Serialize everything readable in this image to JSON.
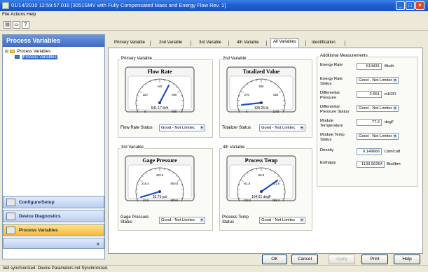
{
  "window": {
    "title": "01/14/2010 12:59:57.010 [3051SMV with Fully Compensated Mass and Energy Flow Rev. 1]"
  },
  "menu": {
    "items": [
      "File",
      "Actions",
      "Help"
    ]
  },
  "toolbar": {
    "icons": [
      "print-icon",
      "print-preview-icon",
      "whats-this-help-icon"
    ]
  },
  "leftpane": {
    "header": "Process Variables",
    "tree": {
      "root": "Process Variables",
      "child": "Process Variables"
    },
    "nav": [
      {
        "label": "Configure/Setup",
        "icon": "wrench-icon"
      },
      {
        "label": "Device Diagnostics",
        "icon": "diagnostics-icon"
      },
      {
        "label": "Process Variables",
        "icon": "variables-icon"
      }
    ],
    "footer_icon": "chevron-more-icon"
  },
  "tabs": [
    "Primary Variable",
    "2nd Variable",
    "3rd Variable",
    "4th Variable",
    "All Variables",
    "Identification"
  ],
  "selected_tab": "All Variables",
  "groups": {
    "primary": {
      "title": "Primary Variable",
      "gauge_title": "Flow Rate",
      "min": "0",
      "max": "880",
      "ticks": [
        "0",
        "220",
        "440",
        "660",
        "880"
      ],
      "value": 541.17,
      "readout": "541.17 lb/h",
      "status_label": "Flow Rate Status",
      "status": "Good - Not Limitec"
    },
    "second": {
      "title": "2nd Variable",
      "gauge_title": "Totalized Value",
      "min": "0",
      "max": "1100",
      "ticks": [
        "0",
        "275",
        "550",
        "825",
        "1100"
      ],
      "value": 109.25,
      "readout": "109.25 lb",
      "status_label": "Totalizer Status",
      "status": "Good - Not Limitec"
    },
    "third": {
      "title": "3rd Variable",
      "gauge_title": "Gage Pressure",
      "min": "-12.9",
      "max": "800.8",
      "ticks": [
        "-12.9",
        "216.4",
        "403.6",
        "600.8",
        "800.8"
      ],
      "value": 32.7,
      "readout": "32.70 psi",
      "status_label": "Gage Pressure Status",
      "status": "Good - Not Limitec"
    },
    "fourth": {
      "title": "4th Variable",
      "gauge_title": "Process Temp",
      "min": "-422.2",
      "max": "298.2",
      "ticks": [
        "-422.2",
        "-61.8",
        "59.8",
        "141.9",
        "298.2"
      ],
      "value": 104.01,
      "readout": "104.01 degF",
      "status_label": "Process Temp Status",
      "status": "Good - Not Limitec"
    }
  },
  "additional": {
    "title": "Additional Measurements",
    "rows": [
      {
        "label": "Energy Rate",
        "value": "613431",
        "unit": "Btu/h"
      },
      {
        "label": "Energy Rate Status",
        "status": "Good - Not Limitec"
      },
      {
        "label": "Differential Pressure",
        "value": "2.651",
        "unit": "inH2O"
      },
      {
        "label": "Differential Pressure Status",
        "status": "Good - Not Limitec"
      },
      {
        "label": "Module Temperature",
        "value": "77.2",
        "unit": "degF"
      },
      {
        "label": "Module Temp Status",
        "status": "Good - Not Limitec"
      },
      {
        "label": "Density",
        "value": "0.149666",
        "unit": "Lbm/cuft"
      },
      {
        "label": "Enthalpy",
        "value": "1133.56264",
        "unit": "Btu/lbm"
      }
    ]
  },
  "buttons": {
    "ok": "OK",
    "cancel": "Cancel",
    "apply": "Apply",
    "print": "Print",
    "help": "Help"
  },
  "status": "last synchronized: Device Parameters not Synchronized.",
  "colors": {
    "titlebar": "#2161d6",
    "accent": "#1f4fb8",
    "needle": "#1d4fc4",
    "active_nav": "#f8b93c"
  }
}
